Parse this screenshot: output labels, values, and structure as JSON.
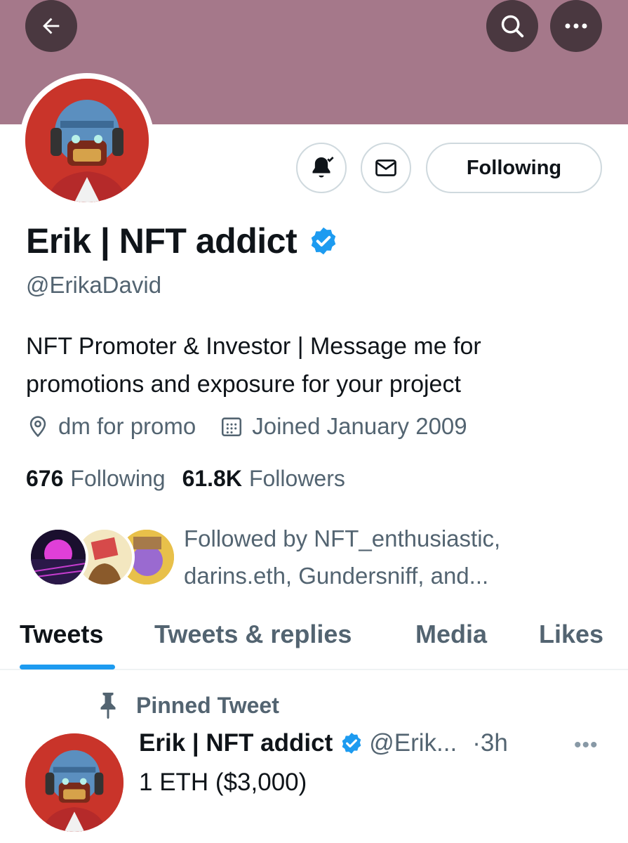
{
  "header": {
    "back_icon": "arrow-left-icon",
    "search_icon": "search-icon",
    "more_icon": "more-horizontal-icon",
    "banner_color": "#a5788a"
  },
  "profile": {
    "name": "Erik | NFT addict",
    "handle": "@ErikaDavid",
    "bio": "NFT Promoter & Investor | Message me for promotions and exposure for your project",
    "location": "dm for promo",
    "joined": "Joined January 2009",
    "following_count": "676",
    "following_label": "Following",
    "followers_count": "61.8K",
    "followers_label": "Followers",
    "followed_by": "Followed by NFT_enthusiastic, darins.eth, Gundersniff, and...",
    "verified_color": "#1d9bf0"
  },
  "actions": {
    "notify_icon": "bell-check-icon",
    "message_icon": "mail-icon",
    "follow_button": "Following"
  },
  "tabs": [
    {
      "label": "Tweets",
      "active": true
    },
    {
      "label": "Tweets & replies",
      "active": false
    },
    {
      "label": "Media",
      "active": false
    },
    {
      "label": "Likes",
      "active": false
    }
  ],
  "pinned": {
    "label": "Pinned Tweet",
    "author_name": "Erik | NFT addict",
    "author_handle": "@Erik...",
    "time": "·3h",
    "text": "1 ETH ($3,000)"
  },
  "colors": {
    "accent": "#1d9bf0",
    "text_secondary": "#536471"
  }
}
